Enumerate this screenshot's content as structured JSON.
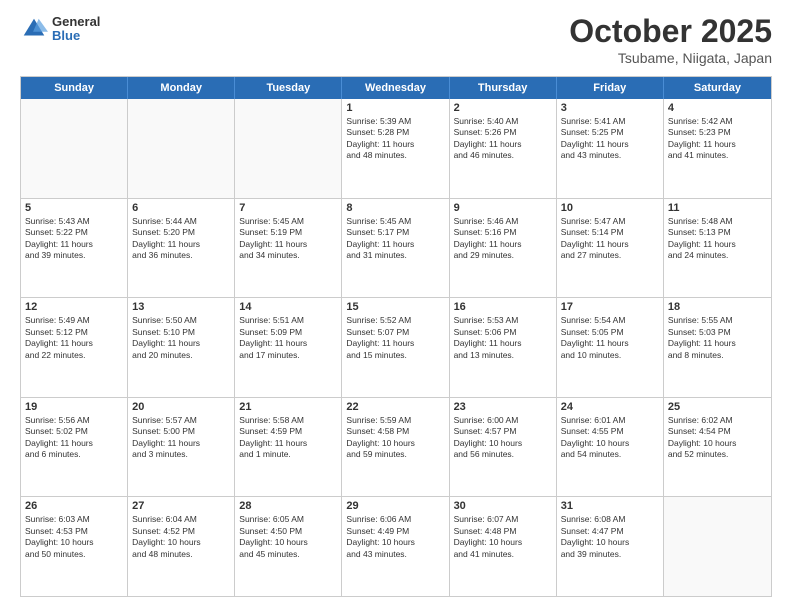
{
  "logo": {
    "general": "General",
    "blue": "Blue"
  },
  "title": "October 2025",
  "subtitle": "Tsubame, Niigata, Japan",
  "weekdays": [
    "Sunday",
    "Monday",
    "Tuesday",
    "Wednesday",
    "Thursday",
    "Friday",
    "Saturday"
  ],
  "rows": [
    [
      {
        "day": "",
        "lines": []
      },
      {
        "day": "",
        "lines": []
      },
      {
        "day": "",
        "lines": []
      },
      {
        "day": "1",
        "lines": [
          "Sunrise: 5:39 AM",
          "Sunset: 5:28 PM",
          "Daylight: 11 hours",
          "and 48 minutes."
        ]
      },
      {
        "day": "2",
        "lines": [
          "Sunrise: 5:40 AM",
          "Sunset: 5:26 PM",
          "Daylight: 11 hours",
          "and 46 minutes."
        ]
      },
      {
        "day": "3",
        "lines": [
          "Sunrise: 5:41 AM",
          "Sunset: 5:25 PM",
          "Daylight: 11 hours",
          "and 43 minutes."
        ]
      },
      {
        "day": "4",
        "lines": [
          "Sunrise: 5:42 AM",
          "Sunset: 5:23 PM",
          "Daylight: 11 hours",
          "and 41 minutes."
        ]
      }
    ],
    [
      {
        "day": "5",
        "lines": [
          "Sunrise: 5:43 AM",
          "Sunset: 5:22 PM",
          "Daylight: 11 hours",
          "and 39 minutes."
        ]
      },
      {
        "day": "6",
        "lines": [
          "Sunrise: 5:44 AM",
          "Sunset: 5:20 PM",
          "Daylight: 11 hours",
          "and 36 minutes."
        ]
      },
      {
        "day": "7",
        "lines": [
          "Sunrise: 5:45 AM",
          "Sunset: 5:19 PM",
          "Daylight: 11 hours",
          "and 34 minutes."
        ]
      },
      {
        "day": "8",
        "lines": [
          "Sunrise: 5:45 AM",
          "Sunset: 5:17 PM",
          "Daylight: 11 hours",
          "and 31 minutes."
        ]
      },
      {
        "day": "9",
        "lines": [
          "Sunrise: 5:46 AM",
          "Sunset: 5:16 PM",
          "Daylight: 11 hours",
          "and 29 minutes."
        ]
      },
      {
        "day": "10",
        "lines": [
          "Sunrise: 5:47 AM",
          "Sunset: 5:14 PM",
          "Daylight: 11 hours",
          "and 27 minutes."
        ]
      },
      {
        "day": "11",
        "lines": [
          "Sunrise: 5:48 AM",
          "Sunset: 5:13 PM",
          "Daylight: 11 hours",
          "and 24 minutes."
        ]
      }
    ],
    [
      {
        "day": "12",
        "lines": [
          "Sunrise: 5:49 AM",
          "Sunset: 5:12 PM",
          "Daylight: 11 hours",
          "and 22 minutes."
        ]
      },
      {
        "day": "13",
        "lines": [
          "Sunrise: 5:50 AM",
          "Sunset: 5:10 PM",
          "Daylight: 11 hours",
          "and 20 minutes."
        ]
      },
      {
        "day": "14",
        "lines": [
          "Sunrise: 5:51 AM",
          "Sunset: 5:09 PM",
          "Daylight: 11 hours",
          "and 17 minutes."
        ]
      },
      {
        "day": "15",
        "lines": [
          "Sunrise: 5:52 AM",
          "Sunset: 5:07 PM",
          "Daylight: 11 hours",
          "and 15 minutes."
        ]
      },
      {
        "day": "16",
        "lines": [
          "Sunrise: 5:53 AM",
          "Sunset: 5:06 PM",
          "Daylight: 11 hours",
          "and 13 minutes."
        ]
      },
      {
        "day": "17",
        "lines": [
          "Sunrise: 5:54 AM",
          "Sunset: 5:05 PM",
          "Daylight: 11 hours",
          "and 10 minutes."
        ]
      },
      {
        "day": "18",
        "lines": [
          "Sunrise: 5:55 AM",
          "Sunset: 5:03 PM",
          "Daylight: 11 hours",
          "and 8 minutes."
        ]
      }
    ],
    [
      {
        "day": "19",
        "lines": [
          "Sunrise: 5:56 AM",
          "Sunset: 5:02 PM",
          "Daylight: 11 hours",
          "and 6 minutes."
        ]
      },
      {
        "day": "20",
        "lines": [
          "Sunrise: 5:57 AM",
          "Sunset: 5:00 PM",
          "Daylight: 11 hours",
          "and 3 minutes."
        ]
      },
      {
        "day": "21",
        "lines": [
          "Sunrise: 5:58 AM",
          "Sunset: 4:59 PM",
          "Daylight: 11 hours",
          "and 1 minute."
        ]
      },
      {
        "day": "22",
        "lines": [
          "Sunrise: 5:59 AM",
          "Sunset: 4:58 PM",
          "Daylight: 10 hours",
          "and 59 minutes."
        ]
      },
      {
        "day": "23",
        "lines": [
          "Sunrise: 6:00 AM",
          "Sunset: 4:57 PM",
          "Daylight: 10 hours",
          "and 56 minutes."
        ]
      },
      {
        "day": "24",
        "lines": [
          "Sunrise: 6:01 AM",
          "Sunset: 4:55 PM",
          "Daylight: 10 hours",
          "and 54 minutes."
        ]
      },
      {
        "day": "25",
        "lines": [
          "Sunrise: 6:02 AM",
          "Sunset: 4:54 PM",
          "Daylight: 10 hours",
          "and 52 minutes."
        ]
      }
    ],
    [
      {
        "day": "26",
        "lines": [
          "Sunrise: 6:03 AM",
          "Sunset: 4:53 PM",
          "Daylight: 10 hours",
          "and 50 minutes."
        ]
      },
      {
        "day": "27",
        "lines": [
          "Sunrise: 6:04 AM",
          "Sunset: 4:52 PM",
          "Daylight: 10 hours",
          "and 48 minutes."
        ]
      },
      {
        "day": "28",
        "lines": [
          "Sunrise: 6:05 AM",
          "Sunset: 4:50 PM",
          "Daylight: 10 hours",
          "and 45 minutes."
        ]
      },
      {
        "day": "29",
        "lines": [
          "Sunrise: 6:06 AM",
          "Sunset: 4:49 PM",
          "Daylight: 10 hours",
          "and 43 minutes."
        ]
      },
      {
        "day": "30",
        "lines": [
          "Sunrise: 6:07 AM",
          "Sunset: 4:48 PM",
          "Daylight: 10 hours",
          "and 41 minutes."
        ]
      },
      {
        "day": "31",
        "lines": [
          "Sunrise: 6:08 AM",
          "Sunset: 4:47 PM",
          "Daylight: 10 hours",
          "and 39 minutes."
        ]
      },
      {
        "day": "",
        "lines": []
      }
    ]
  ]
}
